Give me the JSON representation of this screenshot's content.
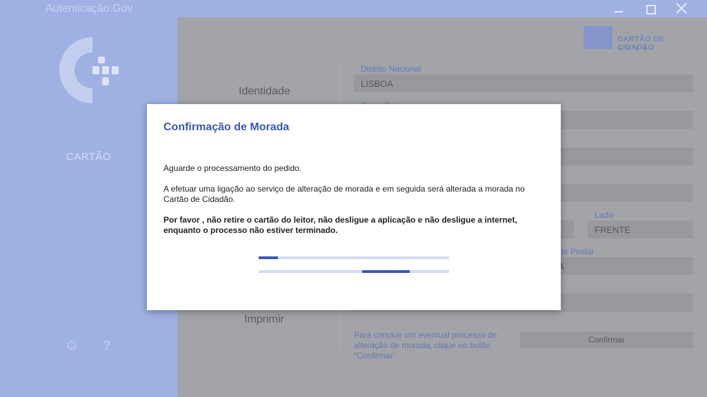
{
  "window": {
    "title": "Autenticação.Gov"
  },
  "sidebar": {
    "card_label": "CARTÃO"
  },
  "brand": {
    "text": "CARTÃO DE CIDADÃO",
    "dots": "● ● ● ●"
  },
  "menu": {
    "identity": "Identidade",
    "print": "Imprimir"
  },
  "fields": {
    "district_label": "Distrito Nacional",
    "district_value": "LISBOA",
    "concelho_label": "Concelho",
    "lado_label": "Lado",
    "lado_value": "FRENTE",
    "localidade_postal_label": "dade Postal",
    "localidade_postal_value": "A"
  },
  "hint": "Para concluir um eventual processo de alteração de morada, clique no botão “Confirmar”",
  "confirm_button": "Confirmar",
  "modal": {
    "title": "Confirmação de Morada",
    "wait_text": "Aguarde o processamento do pedido.",
    "info_text": "A efetuar uma ligação ao serviço de alteração de morada e em seguida será alterada a morada no Cartão de Cidadão.",
    "warning_text": "Por favor , não retire o cartão do leitor, não desligue a aplicação e não desligue a internet, enquanto o processo não estiver terminado."
  },
  "colors": {
    "accent": "#3b57b3",
    "sidebar": "#9fb0e3",
    "overlay_content": "#a3a4a8"
  }
}
